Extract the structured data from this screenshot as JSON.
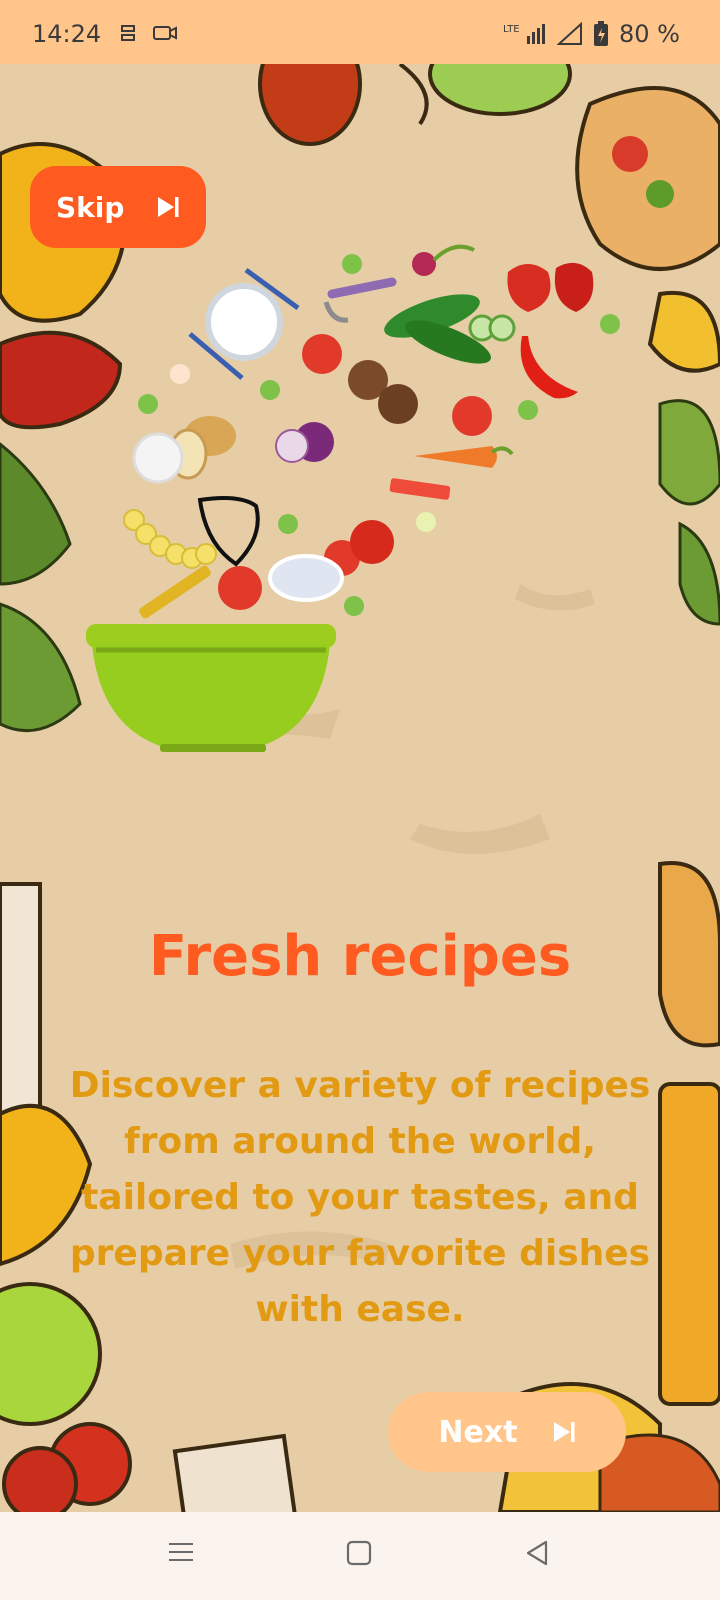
{
  "status_bar": {
    "time": "14:24",
    "network": "LTE",
    "battery": "80 %",
    "icons": [
      "sync-icon",
      "video-icon",
      "signal-icon",
      "wifi-signal-icon",
      "battery-icon"
    ]
  },
  "onboarding": {
    "skip_label": "Skip",
    "title": "Fresh recipes",
    "description": "Discover a variety of recipes from around the world, tailored to your tastes, and prepare your favorite dishes with ease.",
    "next_label": "Next"
  },
  "colors": {
    "accent": "#ff5a1f",
    "next_button": "#ffc58a",
    "description_text": "#e19a12",
    "background": "#e6cda6",
    "bowl": "#97cd1f"
  }
}
